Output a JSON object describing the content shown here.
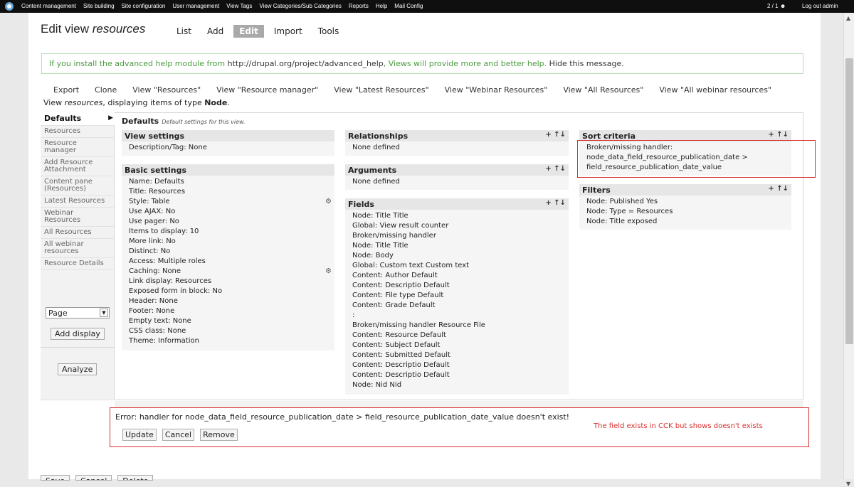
{
  "adminbar": {
    "menu": [
      "Content management",
      "Site building",
      "Site configuration",
      "User management",
      "View Tags",
      "View Categories/Sub Categories",
      "Reports",
      "Help",
      "Mail Config"
    ],
    "users": "2 / 1",
    "logout": "Log out admin"
  },
  "page": {
    "title_prefix": "Edit view ",
    "title_name": "resources",
    "tabs": [
      "List",
      "Add",
      "Edit",
      "Import",
      "Tools"
    ],
    "active_tab": "Edit"
  },
  "help": {
    "prefix": "If you install the advanced help module from ",
    "url": "http://drupal.org/project/advanced_help",
    "middle": ", Views will provide more and better help. ",
    "hide": "Hide this message."
  },
  "extras": [
    "Export",
    "Clone",
    "View \"Resources\"",
    "View \"Resource manager\"",
    "View \"Latest Resources\"",
    "View \"Webinar Resources\"",
    "View \"All Resources\"",
    "View \"All webinar resources\""
  ],
  "viewinfo": {
    "prefix": "View ",
    "name": "resources",
    "middle": ", displaying items of type ",
    "type": "Node",
    "suffix": "."
  },
  "sidebar": {
    "items": [
      "Defaults",
      "Resources",
      "Resource manager",
      "Add Resource Attachment",
      "Content pane (Resources)",
      "Latest Resources",
      "Webinar Resources",
      "All Resources",
      "All webinar resources",
      "Resource Details"
    ],
    "display_select": "Page",
    "add_display": "Add display",
    "analyze": "Analyze"
  },
  "defaults_head": {
    "title": "Defaults",
    "subtitle": "Default settings for this view."
  },
  "view_settings": {
    "title": "View settings",
    "rows": [
      "Description/Tag: None"
    ]
  },
  "basic_settings": {
    "title": "Basic settings",
    "rows": [
      "Name: Defaults",
      "Title: Resources",
      "Style: Table",
      "Use AJAX: No",
      "Use pager: No",
      "Items to display: 10",
      "More link: No",
      "Distinct: No",
      "Access: Multiple roles",
      "Caching: None",
      "Link display: Resources",
      "Exposed form in block: No",
      "Header: None",
      "Footer: None",
      "Empty text: None",
      "CSS class: None",
      "Theme: Information"
    ]
  },
  "relationships": {
    "title": "Relationships",
    "rows": [
      "None defined"
    ]
  },
  "arguments": {
    "title": "Arguments",
    "rows": [
      "None defined"
    ]
  },
  "fields": {
    "title": "Fields",
    "rows": [
      "Node: Title Title",
      "Global: View result counter",
      "Broken/missing handler",
      "Node: Title Title",
      "Node: Body",
      "Global: Custom text Custom text",
      "Content: Author Default",
      "Content: Descriptio Default",
      "Content: File type Default",
      "Content: Grade Default",
      ":",
      "Broken/missing handler Resource File",
      "Content: Resource Default",
      "Content: Subject Default",
      "Content: Submitted Default",
      "Content: Descriptio Default",
      "Content: Descriptio Default",
      "Node: Nid Nid"
    ]
  },
  "sort_criteria": {
    "title": "Sort criteria",
    "rows": [
      "Broken/missing handler:",
      "node_data_field_resource_publication_date >",
      "field_resource_publication_date_value"
    ]
  },
  "filters": {
    "title": "Filters",
    "rows": [
      "Node: Published Yes",
      "Node: Type = Resources",
      "Node: Title exposed"
    ]
  },
  "panel_controls": "+ ↑↓",
  "error": "Error: handler for node_data_field_resource_publication_date > field_resource_publication_date_value doesn't exist!",
  "note": "The field exists in CCK but shows doesn't exists",
  "error_actions": [
    "Update",
    "Cancel",
    "Remove"
  ],
  "bottom_buttons": [
    "Save",
    "Cancel",
    "Delete"
  ],
  "colors": {
    "annotation_red": "#d7302f",
    "help_green": "#4a9c3f",
    "admin_bar": "#0f0f0f"
  }
}
